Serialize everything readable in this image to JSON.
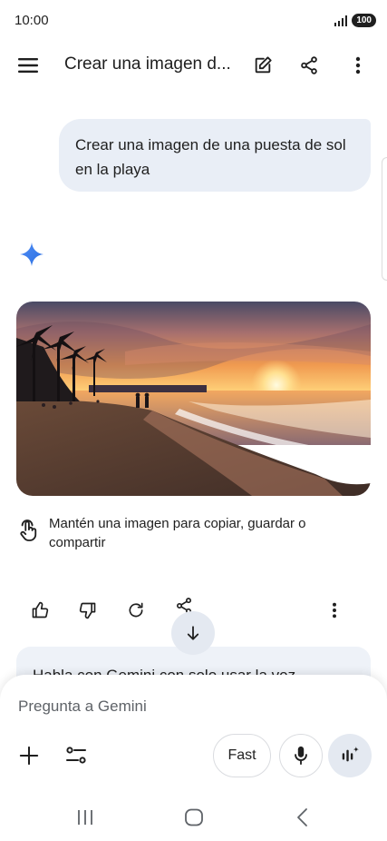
{
  "status": {
    "time": "10:00",
    "battery": "100"
  },
  "header": {
    "title": "Crear una imagen d...",
    "icons": [
      "menu-icon",
      "edit-icon",
      "share-icon",
      "more-vert-icon"
    ]
  },
  "conversation": {
    "user_message": "Crear una imagen de una puesta de sol en la playa",
    "response": {
      "image": "beach-sunset-image",
      "hint": "Mantén una imagen para copiar, guardar o compartir",
      "actions": [
        "thumbs-up-icon",
        "thumbs-down-icon",
        "refresh-icon",
        "share-icon",
        "more-vert-icon"
      ]
    },
    "tip_card": "Habla con Gemini con solo usar la voz"
  },
  "input": {
    "placeholder": "Pregunta a Gemini",
    "model_label": "Fast"
  },
  "colors": {
    "accent": "#4285f4",
    "bubble": "#e9eef6",
    "surface": "#e4e9f1"
  }
}
